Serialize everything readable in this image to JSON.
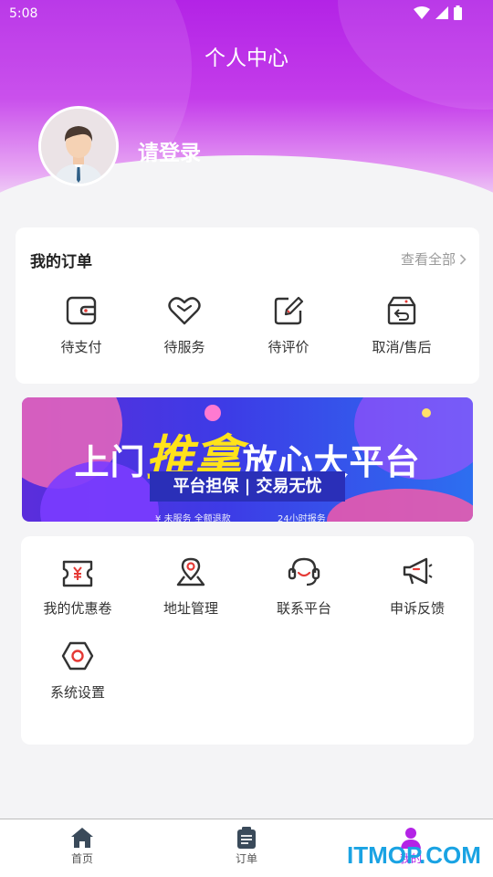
{
  "status_bar": {
    "time": "5:08"
  },
  "header": {
    "title": "个人中心",
    "login_text": "请登录"
  },
  "orders": {
    "title": "我的订单",
    "view_all": "查看全部",
    "items": [
      {
        "label": "待支付",
        "icon": "wallet-icon"
      },
      {
        "label": "待服务",
        "icon": "heart-icon"
      },
      {
        "label": "待评价",
        "icon": "edit-icon"
      },
      {
        "label": "取消/售后",
        "icon": "return-box-icon"
      }
    ]
  },
  "banner": {
    "headline_pre": "上门",
    "headline_hl": "推拿",
    "headline_post": "放心大平台",
    "sub": "平台担保 | 交易无忧",
    "foot_left": "¥ 未服务 全额退款",
    "foot_right": "24小时报务"
  },
  "services": [
    {
      "label": "我的优惠卷",
      "icon": "coupon-icon"
    },
    {
      "label": "地址管理",
      "icon": "location-pin-icon"
    },
    {
      "label": "联系平台",
      "icon": "headset-icon"
    },
    {
      "label": "申诉反馈",
      "icon": "megaphone-icon"
    },
    {
      "label": "系统设置",
      "icon": "settings-hex-icon"
    }
  ],
  "bottom_nav": [
    {
      "label": "首页",
      "icon": "home-icon"
    },
    {
      "label": "订单",
      "icon": "clipboard-icon"
    },
    {
      "label": "我的",
      "icon": "user-icon",
      "active": true
    }
  ],
  "watermark": "ITMOP.COM",
  "colors": {
    "accent": "#b323e6",
    "icon_stroke": "#333333",
    "watermark": "#1aa3e3"
  }
}
